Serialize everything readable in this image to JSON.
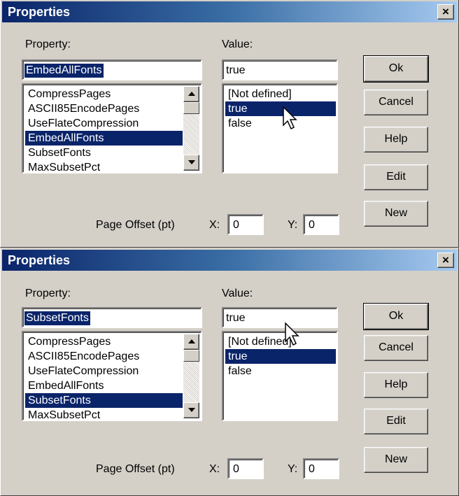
{
  "dialogs": [
    {
      "title": "Properties",
      "close_label": "×",
      "property_label": "Property:",
      "value_label": "Value:",
      "property_value": "EmbedAllFonts",
      "value_value": "true",
      "property_items": [
        "CompressPages",
        "ASCII85EncodePages",
        "UseFlateCompression",
        "EmbedAllFonts",
        "SubsetFonts",
        "MaxSubsetPct"
      ],
      "property_selected_index": 3,
      "value_items": [
        "[Not defined]",
        "true",
        "false"
      ],
      "value_selected_index": 1,
      "buttons": [
        "Ok",
        "Cancel",
        "Help",
        "Edit",
        "New"
      ],
      "offset_label": "Page Offset (pt)",
      "x_label": "X:",
      "x_value": "0",
      "y_label": "Y:",
      "y_value": "0"
    },
    {
      "title": "Properties",
      "close_label": "×",
      "property_label": "Property:",
      "value_label": "Value:",
      "property_value": "SubsetFonts",
      "value_value": "true",
      "property_items": [
        "CompressPages",
        "ASCII85EncodePages",
        "UseFlateCompression",
        "EmbedAllFonts",
        "SubsetFonts",
        "MaxSubsetPct"
      ],
      "property_selected_index": 4,
      "value_items": [
        "[Not defined]",
        "true",
        "false"
      ],
      "value_selected_index": 1,
      "buttons": [
        "Ok",
        "Cancel",
        "Help",
        "Edit",
        "New"
      ],
      "offset_label": "Page Offset (pt)",
      "x_label": "X:",
      "x_value": "0",
      "y_label": "Y:",
      "y_value": "0"
    }
  ],
  "colors": {
    "title_start": "#0a246a",
    "title_end": "#a6caf0",
    "selection": "#0a246a",
    "face": "#d4d0c8"
  },
  "icons": {
    "close": "close-icon",
    "cursor": "mouse-pointer-icon"
  }
}
